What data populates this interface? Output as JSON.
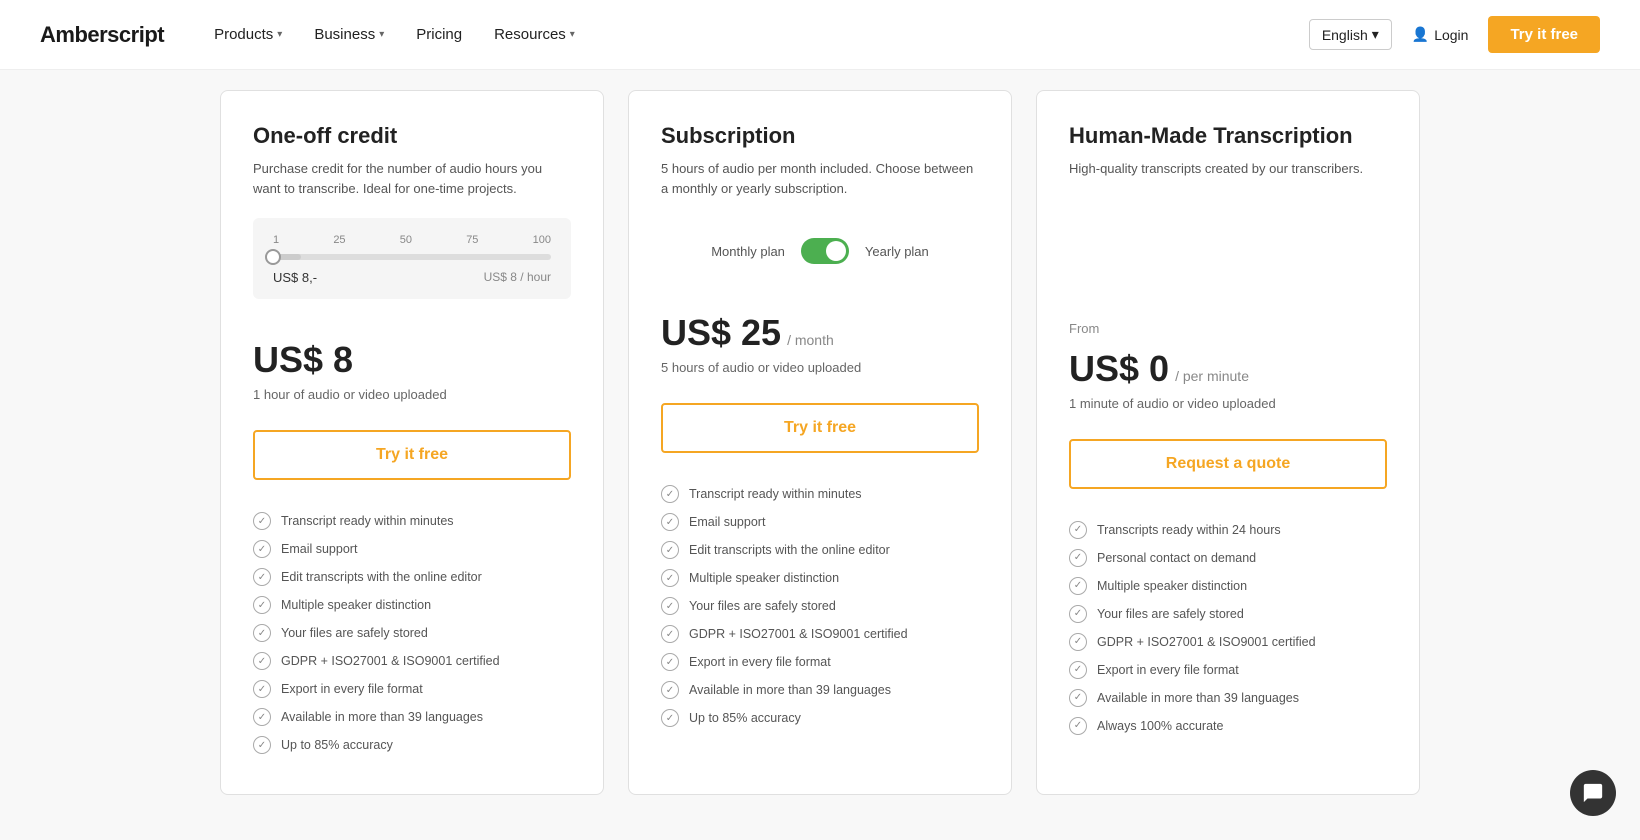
{
  "nav": {
    "logo": "Amberscript",
    "links": [
      {
        "label": "Products",
        "hasChevron": true
      },
      {
        "label": "Business",
        "hasChevron": true
      },
      {
        "label": "Pricing",
        "hasChevron": false
      },
      {
        "label": "Resources",
        "hasChevron": true
      }
    ],
    "language": "English",
    "login_label": "Login",
    "try_label": "Try it free"
  },
  "cards": [
    {
      "id": "one-off",
      "title": "One-off credit",
      "desc": "Purchase credit for the number of audio hours you want to transcribe. Ideal for one-time projects.",
      "widget": "slider",
      "slider": {
        "marks": [
          "1",
          "25",
          "50",
          "75",
          "100"
        ],
        "price_left": "US$ 8,-",
        "price_right": "US$ 8 / hour"
      },
      "from_label": null,
      "price": "US$ 8",
      "price_unit": "",
      "price_per": "",
      "price_desc": "1 hour of audio or video uploaded",
      "cta_label": "Try it free",
      "features": [
        "Transcript ready within minutes",
        "Email support",
        "Edit transcripts with the online editor",
        "Multiple speaker distinction",
        "Your files are safely stored",
        "GDPR + ISO27001 & ISO9001 certified",
        "Export in every file format",
        "Available in more than 39 languages",
        "Up to 85% accuracy"
      ]
    },
    {
      "id": "subscription",
      "title": "Subscription",
      "desc": "5 hours of audio per month included. Choose between a monthly or yearly subscription.",
      "widget": "toggle",
      "toggle": {
        "left_label": "Monthly plan",
        "right_label": "Yearly plan"
      },
      "from_label": null,
      "price": "US$ 25",
      "price_unit": "/ month",
      "price_per": "",
      "price_desc": "5 hours of audio or video uploaded",
      "cta_label": "Try it free",
      "features": [
        "Transcript ready within minutes",
        "Email support",
        "Edit transcripts with the online editor",
        "Multiple speaker distinction",
        "Your files are safely stored",
        "GDPR + ISO27001 & ISO9001 certified",
        "Export in every file format",
        "Available in more than 39 languages",
        "Up to 85% accuracy"
      ]
    },
    {
      "id": "human-made",
      "title": "Human-Made Transcription",
      "desc": "High-quality transcripts created by our transcribers.",
      "widget": "none",
      "from_label": "From",
      "price": "US$ 0",
      "price_unit": "/ per minute",
      "price_per": "",
      "price_desc": "1 minute of audio or video uploaded",
      "cta_label": "Request a quote",
      "features": [
        "Transcripts ready within 24 hours",
        "Personal contact on demand",
        "Multiple speaker distinction",
        "Your files are safely stored",
        "GDPR + ISO27001 & ISO9001 certified",
        "Export in every file format",
        "Available in more than 39 languages",
        "Always 100% accurate"
      ]
    }
  ]
}
